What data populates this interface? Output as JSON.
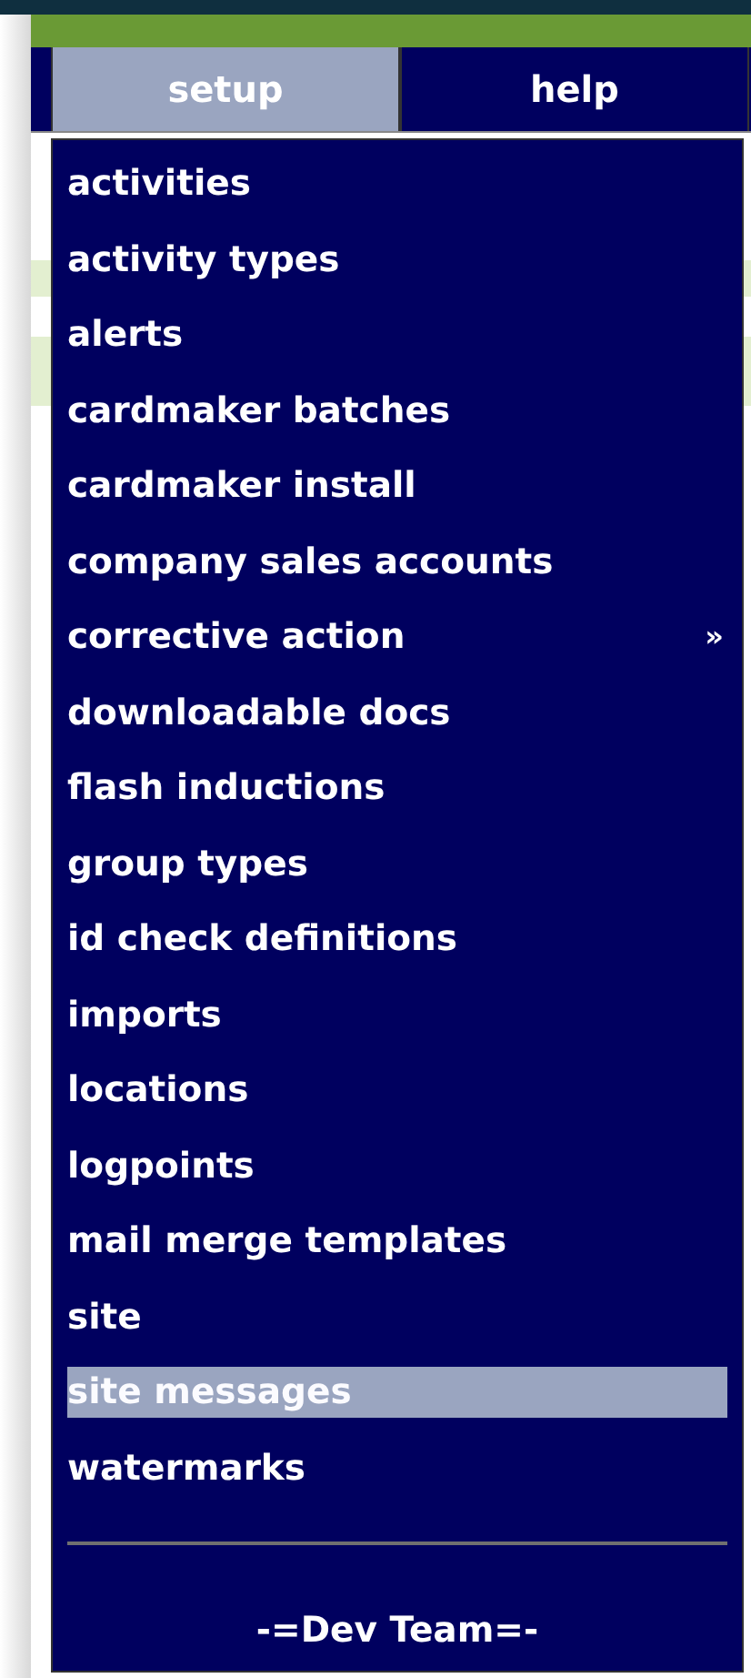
{
  "nav": {
    "tabs": [
      {
        "label": "setup",
        "selected": true
      },
      {
        "label": "help",
        "selected": false
      }
    ]
  },
  "menu": {
    "items": [
      {
        "label": "activities",
        "selected": false
      },
      {
        "label": "activity types",
        "selected": false
      },
      {
        "label": "alerts",
        "selected": false
      },
      {
        "label": "cardmaker batches",
        "selected": false
      },
      {
        "label": "cardmaker install",
        "selected": false
      },
      {
        "label": "company sales accounts",
        "selected": false
      },
      {
        "label": "corrective action",
        "selected": false,
        "submenu_mark": "»"
      },
      {
        "label": "downloadable docs",
        "selected": false
      },
      {
        "label": "flash inductions",
        "selected": false
      },
      {
        "label": "group types",
        "selected": false
      },
      {
        "label": "id check definitions",
        "selected": false
      },
      {
        "label": "imports",
        "selected": false
      },
      {
        "label": "locations",
        "selected": false
      },
      {
        "label": "logpoints",
        "selected": false
      },
      {
        "label": "mail merge templates",
        "selected": false
      },
      {
        "label": "site",
        "selected": false
      },
      {
        "label": "site messages",
        "selected": true
      },
      {
        "label": "watermarks",
        "selected": false
      }
    ],
    "footer": "-=Dev Team=-"
  }
}
